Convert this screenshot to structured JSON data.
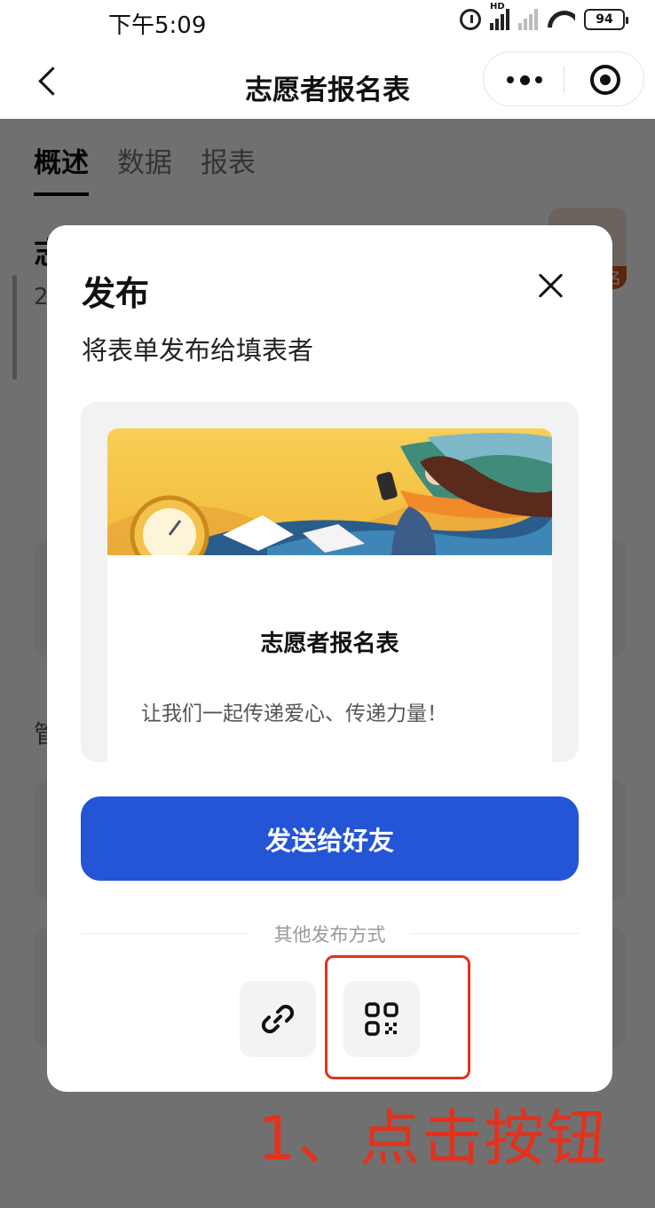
{
  "status_bar": {
    "time": "下午5:09",
    "battery": "94",
    "signal_tag": "HD"
  },
  "nav": {
    "title": "志愿者报名表",
    "icons": [
      "back-arrow-icon",
      "more-dots-icon",
      "target-icon"
    ]
  },
  "background_page": {
    "tabs": [
      "概述",
      "数据",
      "报表"
    ],
    "active_tab": "概述",
    "title_partial": "志",
    "subtitle_partial": "2",
    "badge_partial": "名",
    "section_label_partial": "管"
  },
  "modal": {
    "title": "发布",
    "subtitle": "将表单发布给填表者",
    "preview": {
      "form_title": "志愿者报名表",
      "form_description": "让我们一起传递爱心、传递力量！"
    },
    "send_button": "发送给好友",
    "other_methods_label": "其他发布方式",
    "other_methods": [
      {
        "icon": "link-icon"
      },
      {
        "icon": "qrcode-icon"
      }
    ]
  },
  "annotation": {
    "text": "1、点击按钮",
    "color": "#e2321e"
  },
  "colors": {
    "primary_button": "#2455d6",
    "annotation": "#e2321e"
  }
}
